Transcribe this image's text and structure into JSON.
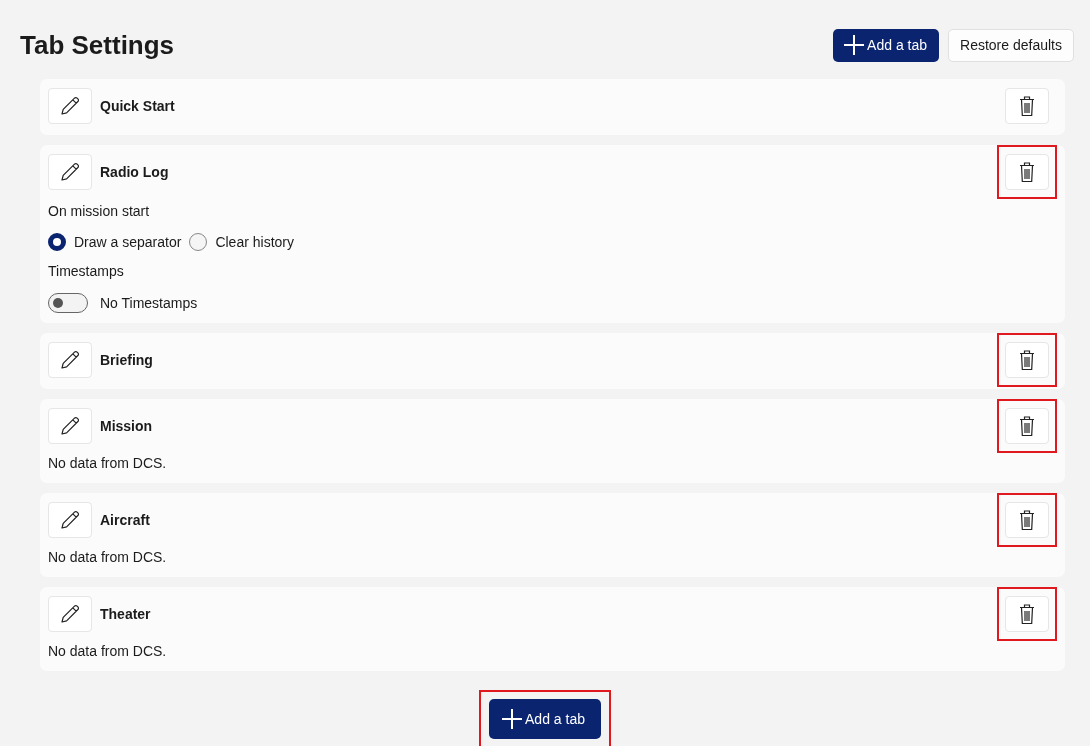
{
  "header": {
    "title": "Tab Settings",
    "add_button": {
      "label": "Add a tab"
    },
    "restore_button": {
      "label": "Restore defaults"
    }
  },
  "tabs": [
    {
      "kind": "plain",
      "name": "Quick Start",
      "delete_highlighted": false
    },
    {
      "kind": "radio_log",
      "name": "Radio Log",
      "delete_highlighted": true,
      "mission_start_label": "On mission start",
      "options": [
        {
          "label": "Draw a separator",
          "selected": true
        },
        {
          "label": "Clear history",
          "selected": false
        }
      ],
      "timestamps_label": "Timestamps",
      "toggle": {
        "label": "No Timestamps",
        "on": false
      }
    },
    {
      "kind": "plain",
      "name": "Briefing",
      "delete_highlighted": true
    },
    {
      "kind": "message",
      "name": "Mission",
      "delete_highlighted": true,
      "message": "No data from DCS."
    },
    {
      "kind": "message",
      "name": "Aircraft",
      "delete_highlighted": true,
      "message": "No data from DCS."
    },
    {
      "kind": "message",
      "name": "Theater",
      "delete_highlighted": true,
      "message": "No data from DCS."
    }
  ],
  "footer": {
    "add_button": {
      "label": "Add a tab",
      "highlighted": true
    }
  }
}
